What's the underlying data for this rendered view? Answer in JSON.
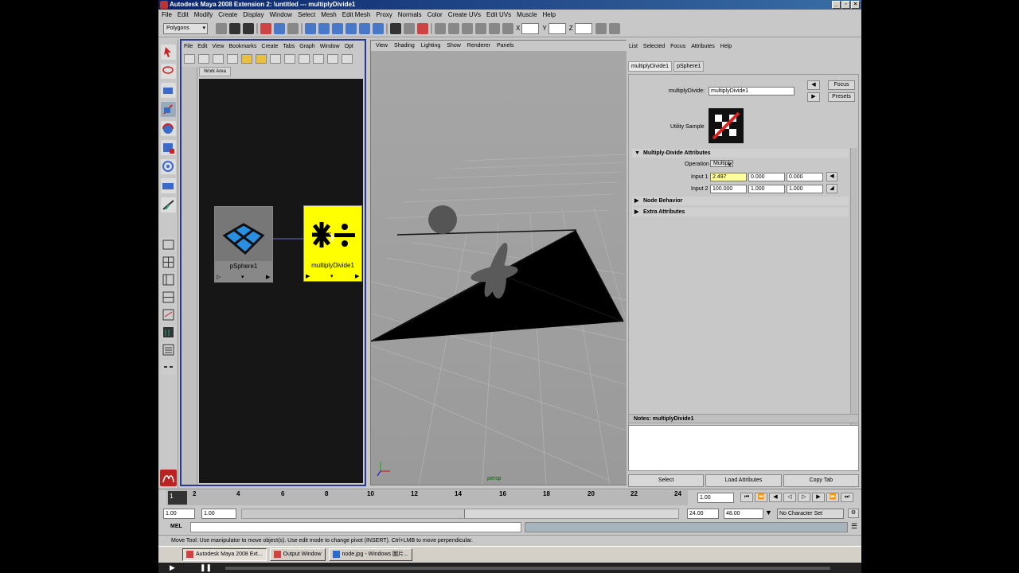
{
  "window": {
    "title": "Autodesk Maya 2008 Extension 2: \\untitled   ---   multiplyDivide1"
  },
  "main_menu": [
    "File",
    "Edit",
    "Modify",
    "Create",
    "Display",
    "Window",
    "Select",
    "Mesh",
    "Edit Mesh",
    "Proxy",
    "Normals",
    "Color",
    "Create UVs",
    "Edit UVs",
    "Muscle",
    "Help"
  ],
  "statusline": {
    "mode": "Polygons",
    "axis_labels": [
      "X",
      "Y",
      "Z"
    ]
  },
  "hypershade": {
    "menu": [
      "File",
      "Edit",
      "View",
      "Bookmarks",
      "Create",
      "Tabs",
      "Graph",
      "Window",
      "Opt"
    ],
    "tab": "Work Area",
    "nodes": [
      {
        "label": "pSphere1"
      },
      {
        "label": "multiplyDivide1"
      }
    ]
  },
  "viewport": {
    "menu": [
      "View",
      "Shading",
      "Lighting",
      "Show",
      "Renderer",
      "Panels"
    ],
    "camera": "persp"
  },
  "attribute_editor": {
    "menu": [
      "List",
      "Selected",
      "Focus",
      "Attributes",
      "Help"
    ],
    "tabs": [
      "multiplyDivide1",
      "pSphere1"
    ],
    "node_type_label": "multiplyDivide:",
    "node_name": "multiplyDivide1",
    "focus_btn": "Focus",
    "presets_btn": "Presets",
    "utility_sample_label": "Utility Sample",
    "sections": {
      "main": "Multiply-Divide Attributes",
      "behavior": "Node Behavior",
      "extra": "Extra Attributes"
    },
    "operation_label": "Operation",
    "operation_value": "Multiply",
    "input1_label": "Input 1",
    "input1": [
      "2.497",
      "0.000",
      "0.000"
    ],
    "input2_label": "Input 2",
    "input2": [
      "100.000",
      "1.000",
      "1.000"
    ],
    "notes_label": "Notes:  multiplyDivide1",
    "bottom_buttons": [
      "Select",
      "Load Attributes",
      "Copy Tab"
    ]
  },
  "timeline": {
    "ticks": [
      "2",
      "4",
      "6",
      "8",
      "10",
      "12",
      "14",
      "16",
      "18",
      "20",
      "22",
      "24"
    ],
    "current_frame": "1",
    "current_time": "1.00"
  },
  "range": {
    "start": "1.00",
    "playback_start": "1.00",
    "playback_end": "24.00",
    "end": "48.00",
    "character_set": "No Character Set"
  },
  "cmdline": {
    "label": "MEL"
  },
  "helpline": "Move Tool: Use manipulator to move object(s). Use edit mode to change pivot (INSERT). Ctrl+LMB to move perpendicular.",
  "taskbar": [
    {
      "label": "Autodesk Maya 2008 Ext..."
    },
    {
      "label": "Output Window"
    },
    {
      "label": "node.jpg - Windows 圖片..."
    }
  ]
}
